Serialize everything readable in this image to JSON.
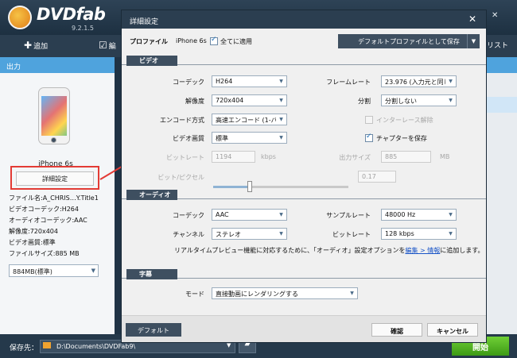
{
  "app": {
    "logo_text": "DVDfab",
    "version": "9.2.1.5",
    "window_controls": [
      "♡",
      "▾",
      "—",
      "✕"
    ]
  },
  "toolbar": {
    "add_label": "追加",
    "edit_label": "編",
    "list_label": "リスト"
  },
  "left_panel": {
    "header": "出力",
    "device_name": "iPhone 6s",
    "advanced_button": "詳細設定",
    "info": [
      "ファイル名:A_CHRIS…Y.Title1",
      "ビデオコーデック:H264",
      "オーディオコーデック:AAC",
      "解像度:720x404",
      "ビデオ画質:標準",
      "ファイルサイズ:885 MB"
    ],
    "size_select": "884MB(標準)"
  },
  "bottom": {
    "save_label": "保存先：",
    "path": "D:\\Documents\\DVDFab9\\",
    "start_button": "開始"
  },
  "dialog": {
    "title": "詳細設定",
    "close": "✕",
    "profile_label": "プロファイル",
    "profile_value": "iPhone 6s",
    "apply_all_label": "全てに適用",
    "default_profile_button": "デフォルトプロファイルとして保存",
    "video": {
      "section": "ビデオ",
      "codec_label": "コーデック",
      "codec": "H264",
      "resolution_label": "解像度",
      "resolution": "720x404",
      "encode_label": "エンコード方式",
      "encode": "高速エンコード (1-パ",
      "quality_label": "ビデオ画質",
      "quality": "標準",
      "bitrate_label": "ビットレート",
      "bitrate": "1194",
      "bitrate_unit": "kbps",
      "bpp_label": "ビット/ピクセル",
      "bpp": "0.17",
      "bpp_slider_fraction": 0.27,
      "framerate_label": "フレームレート",
      "framerate": "23.976 (入力元と同じ",
      "split_label": "分割",
      "split": "分割しない",
      "deinterlace_label": "インターレース解除",
      "chapter_label": "チャプターを保存",
      "output_size_label": "出力サイズ",
      "output_size": "885",
      "output_size_unit": "MB"
    },
    "audio": {
      "section": "オーディオ",
      "codec_label": "コーデック",
      "codec": "AAC",
      "channel_label": "チャンネル",
      "channel": "ステレオ",
      "samplerate_label": "サンプルレート",
      "samplerate": "48000 Hz",
      "bitrate_label": "ビットレート",
      "bitrate": "128 kbps",
      "note_1": "リアルタイムプレビュー機能に対応するために、「オーディオ」設定オプションを",
      "note_link": "編集 > 情報",
      "note_2": "に追加します。"
    },
    "subtitle": {
      "section": "字幕",
      "mode_label": "モード",
      "mode": "直接動画にレンダリングする"
    },
    "default_button": "デフォルト",
    "ok_button": "確認",
    "cancel_button": "キャンセル"
  },
  "colors": {
    "accent_blue": "#4fa3dd",
    "dark_panel": "#2b3e50",
    "start_green": "#4cb01f",
    "callout_red": "#e33b35"
  }
}
